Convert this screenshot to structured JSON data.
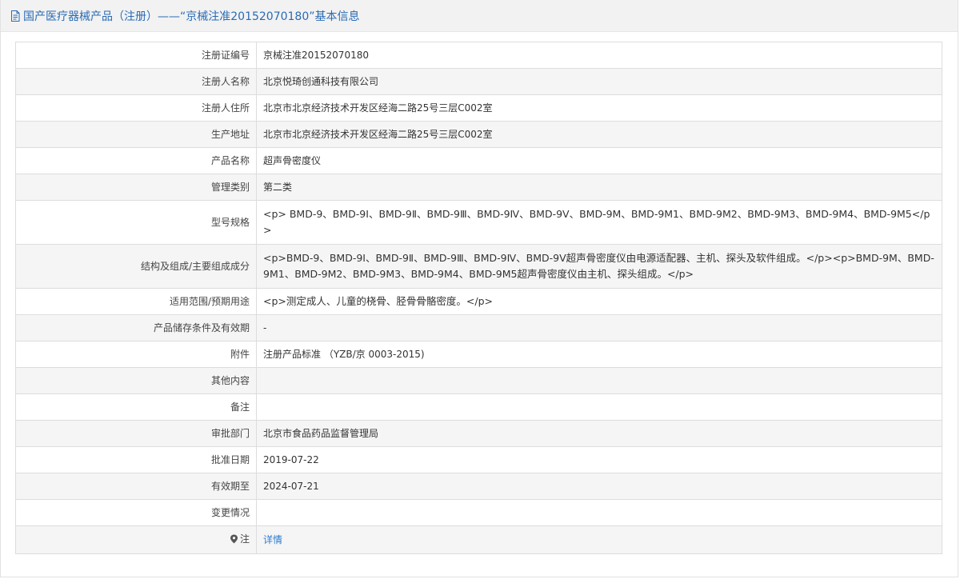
{
  "header": {
    "title": "国产医疗器械产品（注册）——“京械注准20152070180”基本信息",
    "icon": "document-icon"
  },
  "rows": [
    {
      "label": "注册证编号",
      "value": "京械注准20152070180"
    },
    {
      "label": "注册人名称",
      "value": "北京悦琦创通科技有限公司"
    },
    {
      "label": "注册人住所",
      "value": "北京市北京经济技术开发区经海二路25号三层C002室"
    },
    {
      "label": "生产地址",
      "value": "北京市北京经济技术开发区经海二路25号三层C002室"
    },
    {
      "label": "产品名称",
      "value": "超声骨密度仪"
    },
    {
      "label": "管理类别",
      "value": "第二类"
    },
    {
      "label": "型号规格",
      "value": "<p> BMD-9、BMD-9Ⅰ、BMD-9Ⅱ、BMD-9Ⅲ、BMD-9Ⅳ、BMD-9Ⅴ、BMD-9M、BMD-9M1、BMD-9M2、BMD-9M3、BMD-9M4、BMD-9M5</p>"
    },
    {
      "label": "结构及组成/主要组成成分",
      "value": "<p>BMD-9、BMD-9Ⅰ、BMD-9Ⅱ、BMD-9Ⅲ、BMD-9Ⅳ、BMD-9Ⅴ超声骨密度仪由电源适配器、主机、探头及软件组成。</p><p>BMD-9M、BMD-9M1、BMD-9M2、BMD-9M3、BMD-9M4、BMD-9M5超声骨密度仪由主机、探头组成。</p>"
    },
    {
      "label": "适用范围/预期用途",
      "value": "<p>测定成人、儿童的桡骨、胫骨骨骼密度。</p>"
    },
    {
      "label": "产品储存条件及有效期",
      "value": "-"
    },
    {
      "label": "附件",
      "value": "注册产品标准 （YZB/京 0003-2015)"
    },
    {
      "label": "其他内容",
      "value": ""
    },
    {
      "label": "备注",
      "value": ""
    },
    {
      "label": "审批部门",
      "value": "北京市食品药品监督管理局"
    },
    {
      "label": "批准日期",
      "value": "2019-07-22"
    },
    {
      "label": "有效期至",
      "value": "2024-07-21"
    },
    {
      "label": "变更情况",
      "value": ""
    }
  ],
  "note": {
    "label": "注",
    "icon": "map-pin-icon",
    "link_text": "详情"
  }
}
